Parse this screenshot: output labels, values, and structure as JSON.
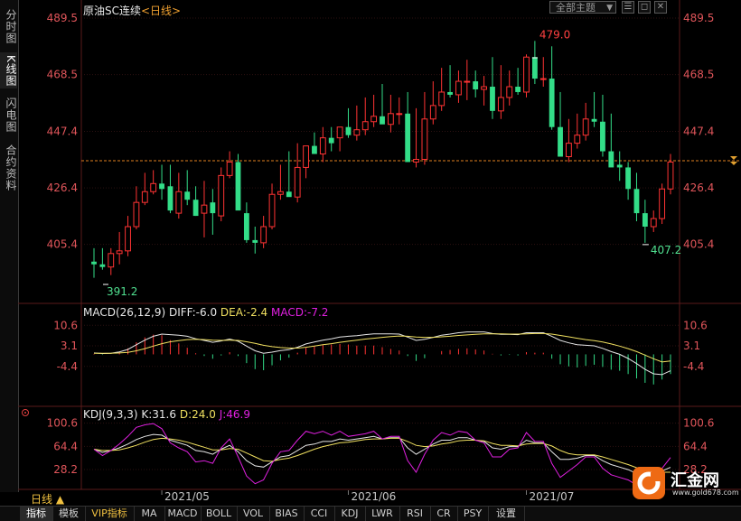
{
  "side_tabs": [
    {
      "label": "分时图",
      "active": false
    },
    {
      "label": "K线图",
      "active": true
    },
    {
      "label": "闪电图",
      "active": false
    },
    {
      "label": "合约资料",
      "active": false
    }
  ],
  "header": {
    "instrument": "原油SC连续",
    "period": "<日线>",
    "theme_button": "全部主题",
    "theme_arrow": "▼"
  },
  "colors": {
    "up": "#ff3333",
    "down": "#33dd88",
    "diff_line": "#e6e6e6",
    "dea_line": "#f0e060",
    "macd_text": "#e020e0",
    "j_line": "#e020e0",
    "grid": "#2b1111",
    "axis_text": "#e0555a",
    "date_text": "#c8c8c8"
  },
  "kline": {
    "y_ticks": [
      "489.5",
      "468.5",
      "447.4",
      "426.4",
      "405.4"
    ],
    "y_tick_values": [
      489.5,
      468.5,
      447.4,
      426.4,
      405.4
    ],
    "high_label": "479.0",
    "low_label": "391.2",
    "recent_low_label": "407.2",
    "last_price": 436.5
  },
  "macd": {
    "title": "MACD(26,12,9)",
    "diff": "DIFF:-6.0",
    "dea": "DEA:-2.4",
    "macd": "MACD:-7.2",
    "y_ticks": [
      "10.6",
      "3.1",
      "-4.4"
    ],
    "y_tick_values": [
      10.6,
      3.1,
      -4.4
    ]
  },
  "kdj": {
    "title": "KDJ(9,3,3)",
    "k": "K:31.6",
    "d": "D:24.0",
    "j": "J:46.9",
    "y_ticks": [
      "100.6",
      "64.4",
      "28.2"
    ],
    "y_tick_values": [
      100.6,
      64.4,
      28.2
    ]
  },
  "date_labels": [
    "2021/05",
    "2021/06",
    "2021/07"
  ],
  "period_bar": {
    "label": "日线 ▲"
  },
  "bottom_tabs": [
    "指标",
    "模板",
    "VIP指标",
    "MA",
    "MACD",
    "BOLL",
    "VOL",
    "BIAS",
    "CCI",
    "KDJ",
    "LWR",
    "RSI",
    "CR",
    "PSY",
    "设置"
  ],
  "watermark": {
    "name": "汇金网",
    "url": "www.gold678.com"
  },
  "chart_data": [
    {
      "type": "candlestick",
      "title": "原油SC连续 <日线>",
      "ylim": [
        391.2,
        489.5
      ],
      "x": [
        "2021-04-21",
        "2021-04-22",
        "2021-04-23",
        "2021-04-26",
        "2021-04-27",
        "2021-04-28",
        "2021-04-29",
        "2021-04-30",
        "2021-05-06",
        "2021-05-07",
        "2021-05-10",
        "2021-05-11",
        "2021-05-12",
        "2021-05-13",
        "2021-05-14",
        "2021-05-17",
        "2021-05-18",
        "2021-05-19",
        "2021-05-20",
        "2021-05-21",
        "2021-05-24",
        "2021-05-25",
        "2021-05-26",
        "2021-05-27",
        "2021-05-28",
        "2021-05-31",
        "2021-06-01",
        "2021-06-02",
        "2021-06-03",
        "2021-06-04",
        "2021-06-07",
        "2021-06-08",
        "2021-06-09",
        "2021-06-10",
        "2021-06-11",
        "2021-06-15",
        "2021-06-16",
        "2021-06-17",
        "2021-06-18",
        "2021-06-21",
        "2021-06-22",
        "2021-06-23",
        "2021-06-24",
        "2021-06-25",
        "2021-06-28",
        "2021-06-29",
        "2021-06-30",
        "2021-07-01",
        "2021-07-02",
        "2021-07-05",
        "2021-07-06",
        "2021-07-07",
        "2021-07-08",
        "2021-07-09",
        "2021-07-12",
        "2021-07-13",
        "2021-07-14",
        "2021-07-15",
        "2021-07-16",
        "2021-07-19",
        "2021-07-20",
        "2021-07-21",
        "2021-07-22",
        "2021-07-23",
        "2021-07-26",
        "2021-07-27",
        "2021-07-28",
        "2021-07-29",
        "2021-07-30"
      ],
      "open": [
        399,
        398,
        397,
        402,
        403,
        412,
        421,
        425,
        428,
        427,
        417,
        425,
        422,
        417,
        421,
        416,
        431,
        436,
        417,
        407,
        406,
        412,
        424,
        425,
        423,
        434,
        442,
        439,
        445,
        445,
        449,
        446,
        448,
        451,
        453,
        450,
        454,
        454,
        436,
        437,
        452,
        457,
        462,
        461,
        466,
        466,
        463,
        464,
        455,
        460,
        464,
        462,
        475,
        467,
        467,
        449,
        438,
        443,
        446,
        452,
        451,
        440,
        435,
        434,
        426,
        417,
        412,
        415,
        426
      ],
      "high": [
        404,
        404,
        404,
        410,
        416,
        427,
        432,
        433,
        435,
        435,
        432,
        433,
        427,
        429,
        426,
        434,
        440,
        439,
        421,
        412,
        416,
        428,
        435,
        440,
        443,
        441,
        447,
        449,
        449,
        449,
        456,
        457,
        460,
        461,
        465,
        461,
        460,
        462,
        456,
        462,
        466,
        471,
        472,
        470,
        474,
        470,
        468,
        475,
        472,
        470,
        471,
        476,
        481,
        475,
        479,
        462,
        452,
        454,
        458,
        462,
        461,
        454,
        440,
        436,
        432,
        422,
        418,
        428,
        439
      ],
      "low": [
        393,
        396,
        394,
        398,
        401,
        411,
        420,
        424,
        422,
        417,
        415,
        420,
        416,
        408,
        409,
        414,
        430,
        426,
        406,
        402,
        404,
        411,
        422,
        424,
        421,
        430,
        440,
        436,
        440,
        440,
        445,
        444,
        446,
        449,
        451,
        447,
        450,
        436,
        434,
        435,
        450,
        455,
        460,
        458,
        459,
        460,
        457,
        452,
        452,
        457,
        461,
        460,
        465,
        464,
        448,
        440,
        436,
        441,
        444,
        449,
        438,
        437,
        429,
        422,
        414,
        406,
        410,
        413,
        424
      ],
      "close": [
        398,
        397,
        402,
        403,
        412,
        421,
        425,
        428,
        426,
        418,
        425,
        422,
        416,
        420,
        417,
        431,
        436,
        418,
        407,
        406,
        412,
        424,
        425,
        423,
        434,
        442,
        439,
        445,
        443,
        449,
        446,
        448,
        451,
        453,
        450,
        454,
        454,
        436,
        437,
        452,
        457,
        462,
        461,
        466,
        466,
        463,
        464,
        455,
        460,
        464,
        462,
        475,
        467,
        467,
        449,
        438,
        443,
        446,
        452,
        451,
        440,
        434,
        434,
        426,
        417,
        412,
        415,
        426,
        436
      ]
    },
    {
      "type": "line",
      "title": "MACD(26,12,9)",
      "ylim": [
        -18,
        14
      ],
      "series": [
        {
          "name": "DIFF",
          "values": [
            0.5,
            0.3,
            0.4,
            0.9,
            1.8,
            3.5,
            5.2,
            6.6,
            7.4,
            7.2,
            7.0,
            6.6,
            5.7,
            5.1,
            4.4,
            4.9,
            5.6,
            4.8,
            3.0,
            1.3,
            0.4,
            0.8,
            1.4,
            1.7,
            2.6,
            3.8,
            4.5,
            5.2,
            5.7,
            6.3,
            6.6,
            6.8,
            7.2,
            7.5,
            7.5,
            7.5,
            7.4,
            6.3,
            5.1,
            5.5,
            6.2,
            7.0,
            7.4,
            7.9,
            8.2,
            8.2,
            8.2,
            7.6,
            7.3,
            7.3,
            7.2,
            7.9,
            7.9,
            7.9,
            6.6,
            5.1,
            4.2,
            3.5,
            3.3,
            3.1,
            2.2,
            1.0,
            0.0,
            -1.5,
            -3.4,
            -5.5,
            -7.1,
            -7.4,
            -6.0
          ]
        },
        {
          "name": "DEA",
          "values": [
            0.4,
            0.4,
            0.4,
            0.5,
            0.7,
            1.3,
            2.1,
            3.0,
            3.9,
            4.6,
            5.0,
            5.4,
            5.5,
            5.4,
            5.2,
            5.1,
            5.2,
            5.1,
            4.6,
            4.0,
            3.3,
            2.8,
            2.5,
            2.3,
            2.3,
            2.6,
            3.0,
            3.5,
            3.9,
            4.4,
            4.8,
            5.2,
            5.6,
            5.9,
            6.2,
            6.5,
            6.7,
            6.6,
            6.3,
            6.2,
            6.2,
            6.4,
            6.6,
            6.9,
            7.1,
            7.3,
            7.5,
            7.5,
            7.5,
            7.4,
            7.4,
            7.5,
            7.6,
            7.6,
            7.4,
            6.9,
            6.4,
            5.9,
            5.4,
            5.0,
            4.5,
            3.8,
            3.0,
            2.1,
            1.0,
            -0.3,
            -1.6,
            -2.8,
            -2.4
          ]
        },
        {
          "name": "MACD",
          "values": [
            0.2,
            -0.2,
            0.0,
            0.8,
            2.2,
            4.4,
            6.2,
            7.2,
            7.0,
            5.2,
            4.0,
            2.4,
            0.4,
            -0.6,
            -1.6,
            -0.4,
            0.8,
            -0.6,
            -3.2,
            -5.4,
            -5.8,
            -4.0,
            -2.2,
            -1.2,
            0.6,
            2.4,
            3.0,
            3.4,
            3.6,
            3.8,
            3.6,
            3.2,
            3.2,
            3.2,
            2.6,
            2.0,
            1.4,
            -0.6,
            -2.4,
            -1.4,
            0.0,
            1.2,
            1.6,
            2.0,
            2.2,
            1.8,
            1.4,
            0.2,
            -0.4,
            -0.2,
            -0.4,
            0.8,
            0.6,
            0.6,
            -1.6,
            -3.6,
            -4.4,
            -4.8,
            -4.2,
            -3.8,
            -4.6,
            -5.6,
            -6.0,
            -7.2,
            -8.8,
            -10.4,
            -11.0,
            -9.2,
            -7.2
          ]
        }
      ]
    },
    {
      "type": "line",
      "title": "KDJ(9,3,3)",
      "ylim": [
        0,
        110
      ],
      "series": [
        {
          "name": "K",
          "values": [
            60,
            55,
            58,
            62,
            68,
            75,
            80,
            83,
            82,
            74,
            70,
            66,
            58,
            56,
            52,
            60,
            66,
            56,
            42,
            34,
            32,
            40,
            48,
            50,
            58,
            66,
            68,
            72,
            72,
            76,
            74,
            76,
            78,
            80,
            76,
            78,
            78,
            62,
            52,
            60,
            68,
            74,
            74,
            78,
            78,
            74,
            72,
            62,
            60,
            64,
            64,
            74,
            70,
            70,
            56,
            44,
            44,
            46,
            50,
            50,
            42,
            36,
            32,
            28,
            22,
            20,
            22,
            26,
            31.6
          ]
        },
        {
          "name": "D",
          "values": [
            60,
            58,
            58,
            59,
            62,
            66,
            71,
            75,
            77,
            76,
            74,
            71,
            67,
            63,
            59,
            59,
            61,
            60,
            54,
            48,
            42,
            41,
            44,
            46,
            50,
            55,
            60,
            64,
            67,
            70,
            71,
            73,
            75,
            76,
            76,
            77,
            77,
            72,
            66,
            64,
            65,
            68,
            70,
            73,
            74,
            74,
            73,
            69,
            66,
            66,
            65,
            68,
            69,
            69,
            65,
            58,
            53,
            51,
            51,
            51,
            48,
            44,
            40,
            36,
            31,
            27,
            25,
            24,
            24.0
          ]
        },
        {
          "name": "J",
          "values": [
            60,
            50,
            58,
            68,
            80,
            94,
            98,
            100,
            92,
            70,
            62,
            56,
            40,
            42,
            38,
            62,
            76,
            48,
            18,
            6,
            12,
            38,
            56,
            58,
            74,
            88,
            84,
            88,
            82,
            88,
            80,
            82,
            84,
            88,
            76,
            80,
            80,
            42,
            24,
            52,
            74,
            86,
            82,
            88,
            86,
            74,
            70,
            48,
            48,
            60,
            62,
            86,
            72,
            72,
            38,
            16,
            26,
            36,
            48,
            48,
            30,
            20,
            16,
            12,
            4,
            6,
            16,
            30,
            46.9
          ]
        }
      ]
    }
  ]
}
